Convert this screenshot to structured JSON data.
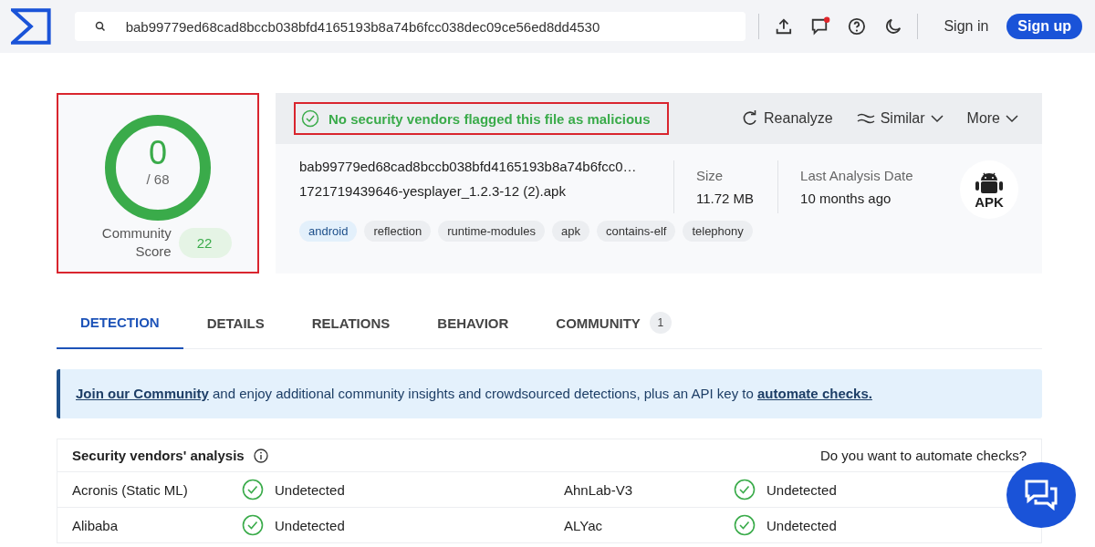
{
  "header": {
    "search_value": "bab99779ed68cad8bccb038bfd4165193b8a74b6fcc038dec09ce56ed8dd4530",
    "notification": true,
    "sign_in": "Sign in",
    "sign_up": "Sign up"
  },
  "score": {
    "detections": "0",
    "total": "/ 68",
    "level": 0,
    "community_label": "Community Score",
    "community_value": "22"
  },
  "summary": {
    "verdict": "No security vendors flagged this file as malicious",
    "actions": [
      {
        "label": "Reanalyze",
        "kind": "reanalyze"
      },
      {
        "label": "Similar",
        "kind": "similar"
      },
      {
        "label": "More",
        "kind": "more"
      }
    ],
    "hash": "bab99779ed68cad8bccb038bfd4165193b8a74b6fcc0…",
    "filename": "1721719439646-yesplayer_1.2.3-12 (2).apk",
    "tags": [
      {
        "label": "android",
        "color": "#e3f0fb"
      },
      {
        "label": "reflection",
        "color": "#eceef1"
      },
      {
        "label": "runtime-modules",
        "color": "#eceef1"
      },
      {
        "label": "apk",
        "color": "#eceef1"
      },
      {
        "label": "contains-elf",
        "color": "#eceef1"
      },
      {
        "label": "telephony",
        "color": "#eceef1"
      }
    ],
    "size_label": "Size",
    "size": "11.72 MB",
    "date_label": "Last Analysis Date",
    "date": "10 months ago",
    "file_type": "APK"
  },
  "tabs": [
    {
      "label": "DETECTION",
      "selected": true
    },
    {
      "label": "DETAILS",
      "selected": false
    },
    {
      "label": "RELATIONS",
      "selected": false
    },
    {
      "label": "BEHAVIOR",
      "selected": false
    },
    {
      "label": "COMMUNITY",
      "selected": false,
      "count": "1"
    }
  ],
  "banner": {
    "link": "Join our Community",
    "text": " and enjoy additional community insights and crowdsourced detections, plus an API key to ",
    "link2": "automate checks."
  },
  "vendors": {
    "title": "Security vendors' analysis",
    "automate": "Do you want to automate checks?",
    "rows": [
      [
        {
          "name": "Acronis (Static ML)",
          "result": "Undetected"
        },
        {
          "name": "AhnLab-V3",
          "result": "Undetected"
        }
      ],
      [
        {
          "name": "Alibaba",
          "result": "Undetected"
        },
        {
          "name": "ALYac",
          "result": "Undetected"
        }
      ]
    ]
  }
}
